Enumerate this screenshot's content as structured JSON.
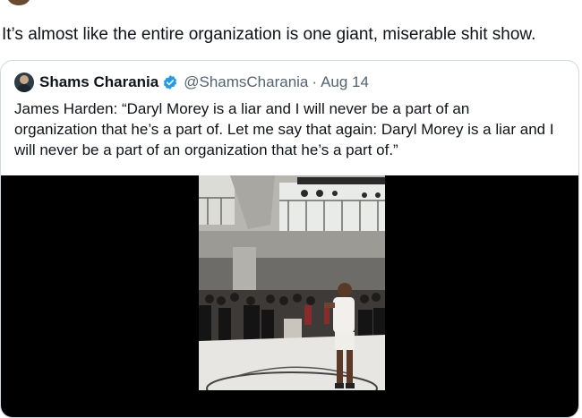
{
  "post": {
    "text": "It’s almost like the entire organization is one giant, miserable shit show."
  },
  "quoted_post": {
    "author_name": "Shams Charania",
    "handle": "@ShamsCharania",
    "separator": "·",
    "date": "Aug 14",
    "verified": true,
    "body_lines": [
      "James Harden: “Daryl Morey is a liar and I will never be a part of an",
      "organization that he’s a part of. Let me say that again: Daryl Morey is a liar and I",
      "will never be a part of an organization that he’s a part of.”"
    ]
  },
  "colors": {
    "verified_badge": "#1d9bf0",
    "secondary_text": "#536471",
    "card_border": "#cfd9de"
  }
}
